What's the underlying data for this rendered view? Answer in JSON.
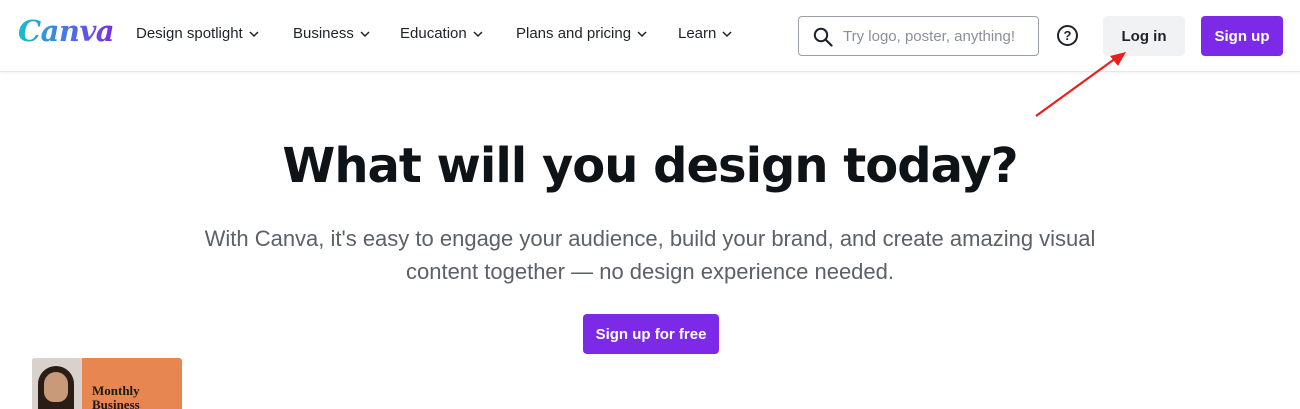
{
  "brand": {
    "logo_text": "Canva",
    "accent_color": "#7d2ae8"
  },
  "nav": {
    "items": [
      {
        "label": "Design spotlight",
        "icon": "chevron-down-icon"
      },
      {
        "label": "Business",
        "icon": "chevron-down-icon"
      },
      {
        "label": "Education",
        "icon": "chevron-down-icon"
      },
      {
        "label": "Plans and pricing",
        "icon": "chevron-down-icon"
      },
      {
        "label": "Learn",
        "icon": "chevron-down-icon"
      }
    ]
  },
  "search": {
    "placeholder": "Try logo, poster, anything!",
    "value": "",
    "icon": "search-icon"
  },
  "help": {
    "label": "?",
    "icon": "help-icon"
  },
  "auth": {
    "login_label": "Log in",
    "signup_label": "Sign up"
  },
  "hero": {
    "title": "What will you design today?",
    "subtitle": "With Canva, it's easy to engage your audience, build your brand, and create amazing visual content together — no design experience needed.",
    "cta_label": "Sign up for free"
  },
  "preview_card": {
    "text": "Monthly Business"
  },
  "annotation": {
    "arrow_color": "#e8201d"
  }
}
